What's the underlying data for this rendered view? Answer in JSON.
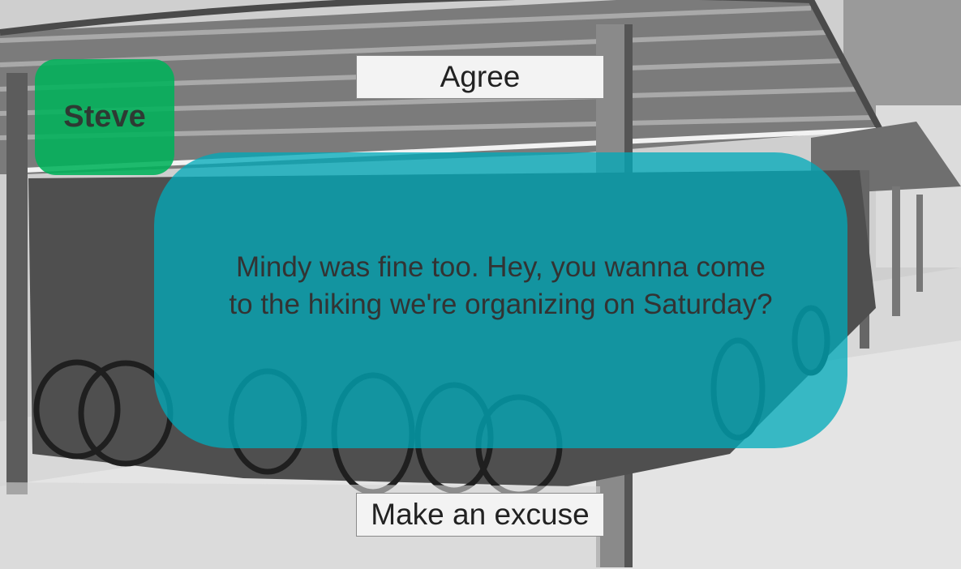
{
  "scene": {
    "background_description_colors": {
      "sky": "#e8e8e8",
      "ground": "#d9d9d9",
      "roof": "#8c8c8c",
      "shadow": "#3a3a3a"
    }
  },
  "speaker": {
    "name": "Steve",
    "color": "#00b25a"
  },
  "dialogue": {
    "text": "Mindy was fine too. Hey, you wanna come to the hiking we're organizing on Saturday?",
    "bubble_color": "#00aab9"
  },
  "choices": {
    "agree_label": "Agree",
    "excuse_label": "Make an excuse"
  }
}
